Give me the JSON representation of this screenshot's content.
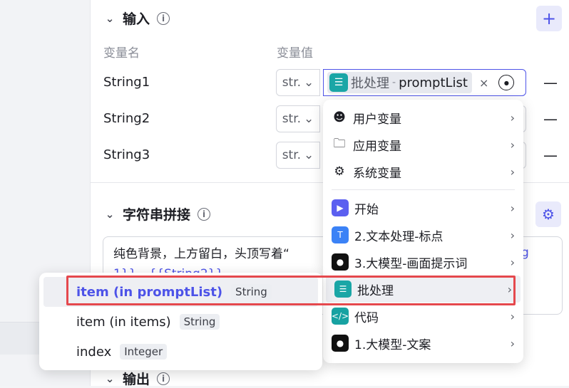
{
  "input_section": {
    "title": "输入",
    "col_name": "变量名",
    "col_value": "变量值"
  },
  "rows": [
    {
      "name": "String1",
      "type": "str."
    },
    {
      "name": "String2",
      "type": "str."
    },
    {
      "name": "String3",
      "type": "str."
    }
  ],
  "ref_tag": {
    "node": "批处理",
    "separator": "-",
    "var": "promptList",
    "clear": "×"
  },
  "concat_section": {
    "title": "字符串拼接",
    "text": "纯色背景，上方留白，头顶写着“",
    "text_line2": "1}}，{{String2}}",
    "text_right": "g"
  },
  "output_section": {
    "title": "输出"
  },
  "menu": {
    "vars": [
      {
        "label": "用户变量",
        "icon": "user-icon"
      },
      {
        "label": "应用变量",
        "icon": "folder-icon"
      },
      {
        "label": "系统变量",
        "icon": "gear-icon"
      }
    ],
    "nodes": [
      {
        "label": "开始",
        "icon": "start-icon",
        "color": "#5b5ff0"
      },
      {
        "label": "2.文本处理-标点",
        "icon": "text-processing-icon",
        "color": "#3b82f6"
      },
      {
        "label": "3.大模型-画面提示词",
        "icon": "llm-icon",
        "color": "#111111"
      },
      {
        "label": "批处理",
        "icon": "batch-icon",
        "color": "#1aa6a6"
      },
      {
        "label": "代码",
        "icon": "code-icon",
        "color": "#17a2a2"
      },
      {
        "label": "1.大模型-文案",
        "icon": "llm-icon",
        "color": "#111111"
      }
    ]
  },
  "submenu": [
    {
      "label": "item (in promptList)",
      "type": "String"
    },
    {
      "label": "item (in items)",
      "type": "String"
    },
    {
      "label": "index",
      "type": "Integer"
    }
  ]
}
